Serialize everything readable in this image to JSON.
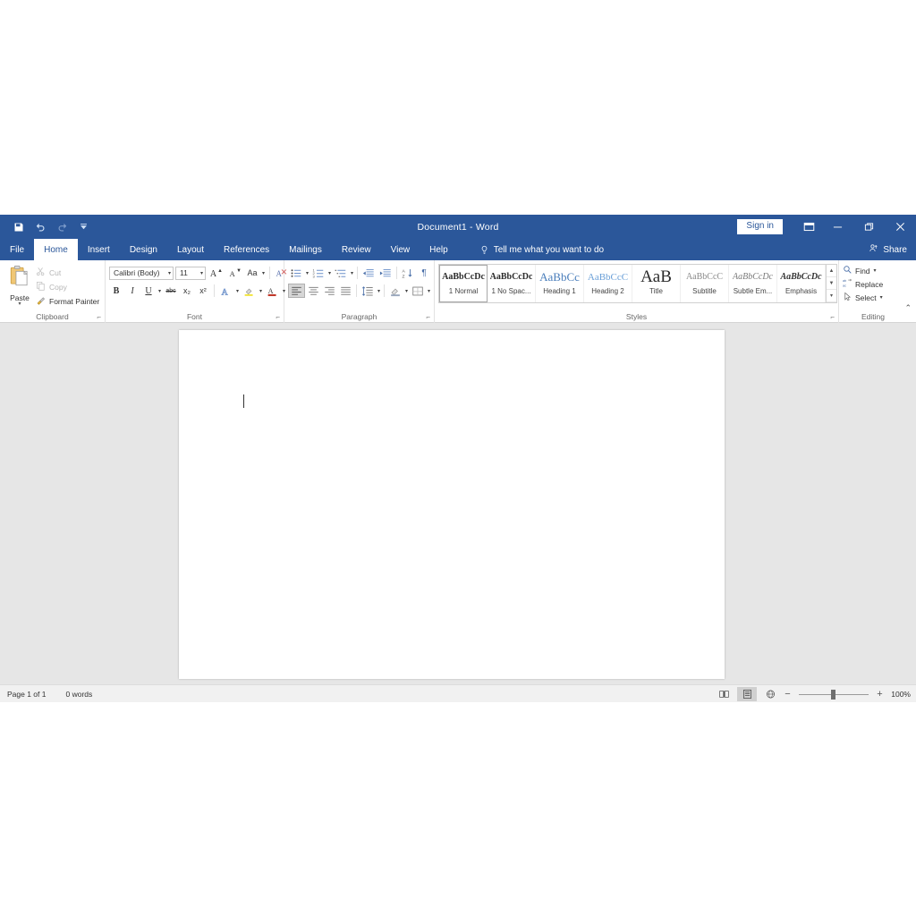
{
  "window": {
    "title": "Document1  -  Word",
    "signin_label": "Sign in",
    "ribbon_display_icon": "ribbon-display-options-icon",
    "minimize_icon": "minimize-icon",
    "restore_icon": "restore-icon",
    "close_icon": "close-icon"
  },
  "quick_access": {
    "save_icon": "save-icon",
    "undo_icon": "undo-icon",
    "redo_icon": "redo-icon",
    "customize_icon": "chevron-down-icon"
  },
  "tabs": [
    {
      "label": "File",
      "active": false
    },
    {
      "label": "Home",
      "active": true
    },
    {
      "label": "Insert",
      "active": false
    },
    {
      "label": "Design",
      "active": false
    },
    {
      "label": "Layout",
      "active": false
    },
    {
      "label": "References",
      "active": false
    },
    {
      "label": "Mailings",
      "active": false
    },
    {
      "label": "Review",
      "active": false
    },
    {
      "label": "View",
      "active": false
    },
    {
      "label": "Help",
      "active": false
    }
  ],
  "tell_me": {
    "label": "Tell me what you want to do",
    "icon": "lightbulb-icon"
  },
  "share": {
    "label": "Share",
    "icon": "share-person-icon"
  },
  "ribbon": {
    "collapse_icon": "chevron-up-icon",
    "dialog_launcher_glyph": "⌐",
    "groups": {
      "clipboard": {
        "label": "Clipboard",
        "paste": {
          "label": "Paste",
          "icon": "clipboard-paste-icon"
        },
        "cut": {
          "label": "Cut",
          "icon": "scissors-icon",
          "enabled": false
        },
        "copy": {
          "label": "Copy",
          "icon": "copy-icon",
          "enabled": false
        },
        "format_painter": {
          "label": "Format Painter",
          "icon": "paintbrush-icon",
          "enabled": true
        }
      },
      "font": {
        "label": "Font",
        "font_name": "Calibri (Body)",
        "font_size": "11",
        "grow_font": "A",
        "shrink_font": "A",
        "change_case": "Aa",
        "clear_formatting": "clear-formatting-icon",
        "bold": "B",
        "italic": "I",
        "underline": "U",
        "strikethrough": "abc",
        "subscript": "x₂",
        "superscript": "x²",
        "text_effects": "A",
        "highlight_color": "highlight-icon",
        "font_color": "A"
      },
      "paragraph": {
        "label": "Paragraph",
        "bullets": "bullets-icon",
        "numbering": "numbering-icon",
        "multilevel_list": "multilevel-list-icon",
        "decrease_indent": "decrease-indent-icon",
        "increase_indent": "increase-indent-icon",
        "sort": "sort-icon",
        "show_marks": "¶",
        "align_left": "align-left-icon",
        "align_center": "align-center-icon",
        "align_right": "align-right-icon",
        "justify": "justify-icon",
        "line_spacing": "line-spacing-icon",
        "shading": "shading-icon",
        "borders": "borders-icon"
      },
      "styles": {
        "label": "Styles",
        "items": [
          {
            "preview": "AaBbCcDc",
            "name": "1 Normal",
            "selected": true,
            "style": "normal"
          },
          {
            "preview": "AaBbCcDc",
            "name": "1 No Spac...",
            "selected": false,
            "style": "normal"
          },
          {
            "preview": "AaBbCc",
            "name": "Heading 1",
            "selected": false,
            "style": "heading1"
          },
          {
            "preview": "AaBbCcC",
            "name": "Heading 2",
            "selected": false,
            "style": "heading2"
          },
          {
            "preview": "AaB",
            "name": "Title",
            "selected": false,
            "style": "title"
          },
          {
            "preview": "AaBbCcC",
            "name": "Subtitle",
            "selected": false,
            "style": "subtitle"
          },
          {
            "preview": "AaBbCcDc",
            "name": "Subtle Em...",
            "selected": false,
            "style": "subtle-emphasis"
          },
          {
            "preview": "AaBbCcDc",
            "name": "Emphasis",
            "selected": false,
            "style": "emphasis"
          }
        ],
        "scroll_up": "▲",
        "scroll_down": "▼",
        "scroll_more": "▾"
      },
      "editing": {
        "label": "Editing",
        "find": {
          "label": "Find",
          "icon": "search-icon"
        },
        "replace": {
          "label": "Replace",
          "icon": "replace-icon"
        },
        "select": {
          "label": "Select",
          "icon": "select-icon"
        }
      }
    }
  },
  "document": {
    "caret_visible": true
  },
  "statusbar": {
    "page": "Page 1 of 1",
    "words": "0 words",
    "read_mode_icon": "read-mode-icon",
    "print_layout_icon": "print-layout-icon",
    "web_layout_icon": "web-layout-icon",
    "zoom_out": "−",
    "zoom_in": "+",
    "zoom_level": "100%"
  },
  "colors": {
    "titlebar": "#2b579a",
    "ribbon_bg": "#ffffff",
    "doc_bg": "#e6e6e6",
    "page": "#ffffff",
    "status_bg": "#f1f1f1"
  }
}
